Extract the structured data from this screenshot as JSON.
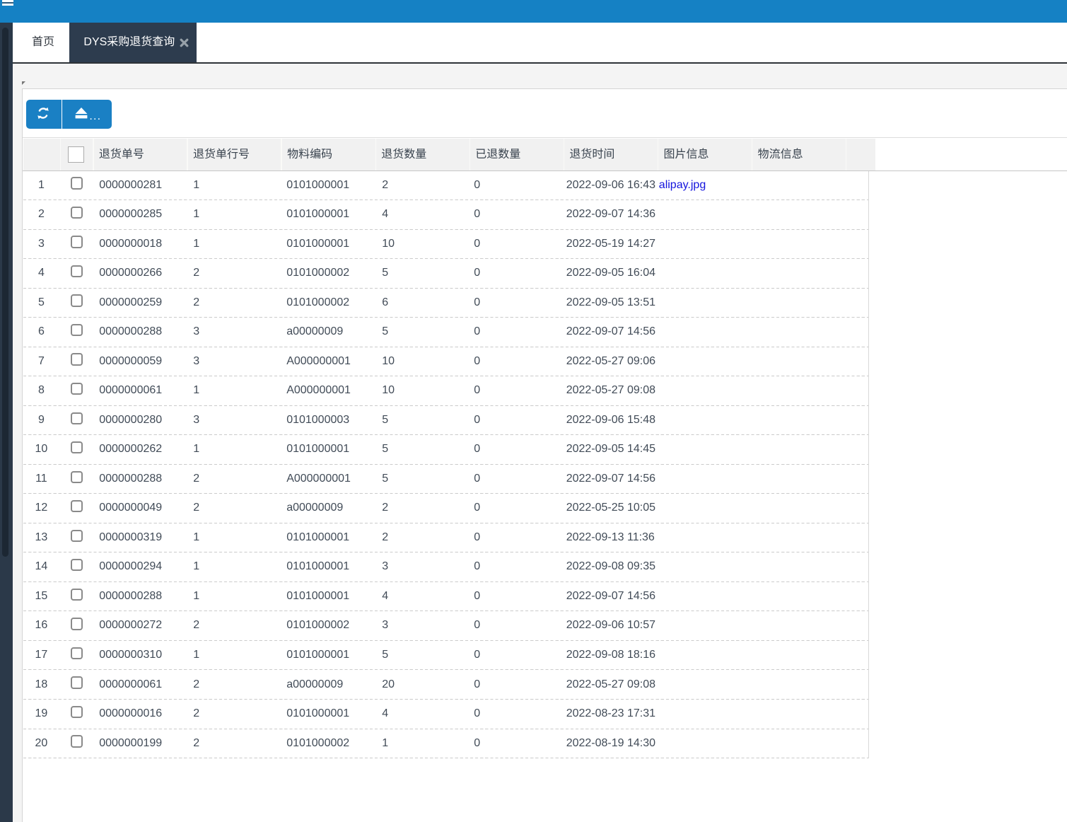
{
  "topbar": {
    "icon": "hamburger-icon"
  },
  "tabs": [
    {
      "label": "首页",
      "active": false,
      "closable": false
    },
    {
      "label": "DYS采购退货查询",
      "active": true,
      "closable": true
    }
  ],
  "toolbar": {
    "buttons": [
      {
        "icon": "refresh-icon",
        "label": ""
      },
      {
        "icon": "eject-icon",
        "label": "..."
      }
    ]
  },
  "table": {
    "columns": [
      {
        "key": "index",
        "label": ""
      },
      {
        "key": "check",
        "label": ""
      },
      {
        "key": "return_no",
        "label": "退货单号"
      },
      {
        "key": "line_no",
        "label": "退货单行号"
      },
      {
        "key": "material_code",
        "label": "物料编码"
      },
      {
        "key": "return_qty",
        "label": "退货数量"
      },
      {
        "key": "returned_qty",
        "label": "已退数量"
      },
      {
        "key": "return_time",
        "label": "退货时间"
      },
      {
        "key": "image_info",
        "label": "图片信息"
      },
      {
        "key": "logistics_info",
        "label": "物流信息"
      }
    ],
    "header_checkbox_checked": false,
    "rows": [
      {
        "index": 1,
        "checked": false,
        "return_no": "0000000281",
        "line_no": "1",
        "material_code": "0101000001",
        "return_qty": "2",
        "returned_qty": "0",
        "return_time": "2022-09-06 16:43",
        "image_info": "alipay.jpg",
        "logistics_info": ""
      },
      {
        "index": 2,
        "checked": false,
        "return_no": "0000000285",
        "line_no": "1",
        "material_code": "0101000001",
        "return_qty": "4",
        "returned_qty": "0",
        "return_time": "2022-09-07 14:36",
        "image_info": "",
        "logistics_info": ""
      },
      {
        "index": 3,
        "checked": false,
        "return_no": "0000000018",
        "line_no": "1",
        "material_code": "0101000001",
        "return_qty": "10",
        "returned_qty": "0",
        "return_time": "2022-05-19 14:27",
        "image_info": "",
        "logistics_info": ""
      },
      {
        "index": 4,
        "checked": false,
        "return_no": "0000000266",
        "line_no": "2",
        "material_code": "0101000002",
        "return_qty": "5",
        "returned_qty": "0",
        "return_time": "2022-09-05 16:04",
        "image_info": "",
        "logistics_info": ""
      },
      {
        "index": 5,
        "checked": false,
        "return_no": "0000000259",
        "line_no": "2",
        "material_code": "0101000002",
        "return_qty": "6",
        "returned_qty": "0",
        "return_time": "2022-09-05 13:51",
        "image_info": "",
        "logistics_info": ""
      },
      {
        "index": 6,
        "checked": false,
        "return_no": "0000000288",
        "line_no": "3",
        "material_code": "a00000009",
        "return_qty": "5",
        "returned_qty": "0",
        "return_time": "2022-09-07 14:56",
        "image_info": "",
        "logistics_info": ""
      },
      {
        "index": 7,
        "checked": false,
        "return_no": "0000000059",
        "line_no": "3",
        "material_code": "A000000001",
        "return_qty": "10",
        "returned_qty": "0",
        "return_time": "2022-05-27 09:06",
        "image_info": "",
        "logistics_info": ""
      },
      {
        "index": 8,
        "checked": false,
        "return_no": "0000000061",
        "line_no": "1",
        "material_code": "A000000001",
        "return_qty": "10",
        "returned_qty": "0",
        "return_time": "2022-05-27 09:08",
        "image_info": "",
        "logistics_info": ""
      },
      {
        "index": 9,
        "checked": false,
        "return_no": "0000000280",
        "line_no": "3",
        "material_code": "0101000003",
        "return_qty": "5",
        "returned_qty": "0",
        "return_time": "2022-09-06 15:48",
        "image_info": "",
        "logistics_info": ""
      },
      {
        "index": 10,
        "checked": false,
        "return_no": "0000000262",
        "line_no": "1",
        "material_code": "0101000001",
        "return_qty": "5",
        "returned_qty": "0",
        "return_time": "2022-09-05 14:45",
        "image_info": "",
        "logistics_info": ""
      },
      {
        "index": 11,
        "checked": false,
        "return_no": "0000000288",
        "line_no": "2",
        "material_code": "A000000001",
        "return_qty": "5",
        "returned_qty": "0",
        "return_time": "2022-09-07 14:56",
        "image_info": "",
        "logistics_info": ""
      },
      {
        "index": 12,
        "checked": false,
        "return_no": "0000000049",
        "line_no": "2",
        "material_code": "a00000009",
        "return_qty": "2",
        "returned_qty": "0",
        "return_time": "2022-05-25 10:05",
        "image_info": "",
        "logistics_info": ""
      },
      {
        "index": 13,
        "checked": false,
        "return_no": "0000000319",
        "line_no": "1",
        "material_code": "0101000001",
        "return_qty": "2",
        "returned_qty": "0",
        "return_time": "2022-09-13 11:36",
        "image_info": "",
        "logistics_info": ""
      },
      {
        "index": 14,
        "checked": false,
        "return_no": "0000000294",
        "line_no": "1",
        "material_code": "0101000001",
        "return_qty": "3",
        "returned_qty": "0",
        "return_time": "2022-09-08 09:35",
        "image_info": "",
        "logistics_info": ""
      },
      {
        "index": 15,
        "checked": false,
        "return_no": "0000000288",
        "line_no": "1",
        "material_code": "0101000001",
        "return_qty": "4",
        "returned_qty": "0",
        "return_time": "2022-09-07 14:56",
        "image_info": "",
        "logistics_info": ""
      },
      {
        "index": 16,
        "checked": false,
        "return_no": "0000000272",
        "line_no": "2",
        "material_code": "0101000002",
        "return_qty": "3",
        "returned_qty": "0",
        "return_time": "2022-09-06 10:57",
        "image_info": "",
        "logistics_info": ""
      },
      {
        "index": 17,
        "checked": false,
        "return_no": "0000000310",
        "line_no": "1",
        "material_code": "0101000001",
        "return_qty": "5",
        "returned_qty": "0",
        "return_time": "2022-09-08 18:16",
        "image_info": "",
        "logistics_info": ""
      },
      {
        "index": 18,
        "checked": false,
        "return_no": "0000000061",
        "line_no": "2",
        "material_code": "a00000009",
        "return_qty": "20",
        "returned_qty": "0",
        "return_time": "2022-05-27 09:08",
        "image_info": "",
        "logistics_info": ""
      },
      {
        "index": 19,
        "checked": false,
        "return_no": "0000000016",
        "line_no": "2",
        "material_code": "0101000001",
        "return_qty": "4",
        "returned_qty": "0",
        "return_time": "2022-08-23 17:31",
        "image_info": "",
        "logistics_info": ""
      },
      {
        "index": 20,
        "checked": false,
        "return_no": "0000000199",
        "line_no": "2",
        "material_code": "0101000002",
        "return_qty": "1",
        "returned_qty": "0",
        "return_time": "2022-08-19 14:30",
        "image_info": "",
        "logistics_info": ""
      }
    ]
  },
  "colors": {
    "topbar_blue": "#1581c4",
    "button_blue": "#1a80c4",
    "dark_slate": "#2d3c4e",
    "content_gray": "#f4f4f4",
    "header_gray": "#f1f1f1",
    "link_blue": "#1414dd",
    "text": "#414b57"
  }
}
